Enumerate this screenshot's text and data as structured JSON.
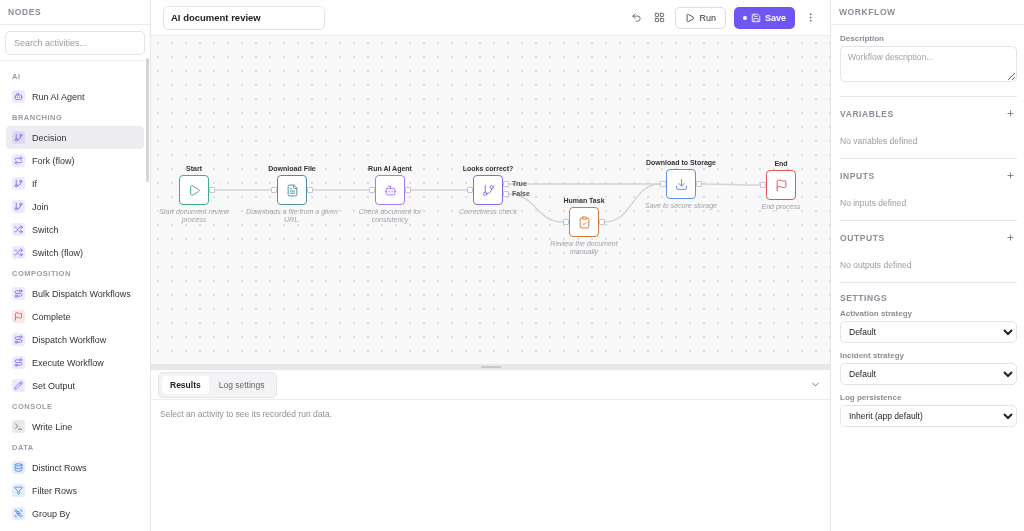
{
  "sidebar": {
    "title": "NODES",
    "search": {
      "placeholder": "Search activities..."
    },
    "groups": [
      {
        "label": "AI",
        "items": [
          {
            "label": "Run AI Agent",
            "selected": false
          }
        ]
      },
      {
        "label": "BRANCHING",
        "items": [
          {
            "label": "Decision",
            "selected": true
          },
          {
            "label": "Fork (flow)",
            "selected": false
          },
          {
            "label": "If",
            "selected": false
          },
          {
            "label": "Join",
            "selected": false
          },
          {
            "label": "Switch",
            "selected": false
          },
          {
            "label": "Switch (flow)",
            "selected": false
          }
        ]
      },
      {
        "label": "COMPOSITION",
        "items": [
          {
            "label": "Bulk Dispatch Workflows",
            "selected": false
          },
          {
            "label": "Complete",
            "selected": false
          },
          {
            "label": "Dispatch Workflow",
            "selected": false
          },
          {
            "label": "Execute Workflow",
            "selected": false
          },
          {
            "label": "Set Output",
            "selected": false
          }
        ]
      },
      {
        "label": "CONSOLE",
        "items": [
          {
            "label": "Write Line",
            "selected": false
          }
        ]
      },
      {
        "label": "DATA",
        "items": [
          {
            "label": "Distinct Rows",
            "selected": false
          },
          {
            "label": "Filter Rows",
            "selected": false
          },
          {
            "label": "Group By",
            "selected": false
          }
        ]
      }
    ]
  },
  "toolbar": {
    "title": "AI document review",
    "run_label": "Run",
    "save": {
      "label": "Save",
      "unsaved": true
    }
  },
  "canvas": {
    "nodes": [
      {
        "title": "Start",
        "description": "Start document review process",
        "color": "#3fae8c"
      },
      {
        "title": "Download File",
        "description": "Downloads a file from a given URL.",
        "color": "#4a8fa3"
      },
      {
        "title": "Run AI Agent",
        "description": "Check document for consistency",
        "color": "#a07cf7"
      },
      {
        "title": "Looks correct?",
        "description": "Correctness check",
        "color": "#7b6cf2",
        "ports": [
          "True",
          "False"
        ]
      },
      {
        "title": "Human Task",
        "description": "Review the document manually",
        "color": "#cf7a3e"
      },
      {
        "title": "Download to Storage",
        "description": "Save to secure storage",
        "color": "#5b8ef0"
      },
      {
        "title": "End",
        "description": "End process",
        "color": "#e05555"
      }
    ]
  },
  "bottom_panel": {
    "tabs": [
      {
        "label": "Results",
        "selected": true
      },
      {
        "label": "Log settings",
        "selected": false
      }
    ],
    "message": "Select an activity to see its recorded run data."
  },
  "inspector": {
    "title": "WORKFLOW",
    "description": {
      "label": "Description",
      "placeholder": "Workflow description..."
    },
    "sections": [
      {
        "title": "VARIABLES",
        "empty": "No variables defined"
      },
      {
        "title": "INPUTS",
        "empty": "No inputs defined"
      },
      {
        "title": "OUTPUTS",
        "empty": "No outputs defined"
      }
    ],
    "settings": {
      "title": "SETTINGS",
      "fields": [
        {
          "label": "Activation strategy",
          "value": "Default"
        },
        {
          "label": "Incident strategy",
          "value": "Default"
        },
        {
          "label": "Log persistence",
          "value": "Inherit (app default)"
        }
      ]
    }
  }
}
